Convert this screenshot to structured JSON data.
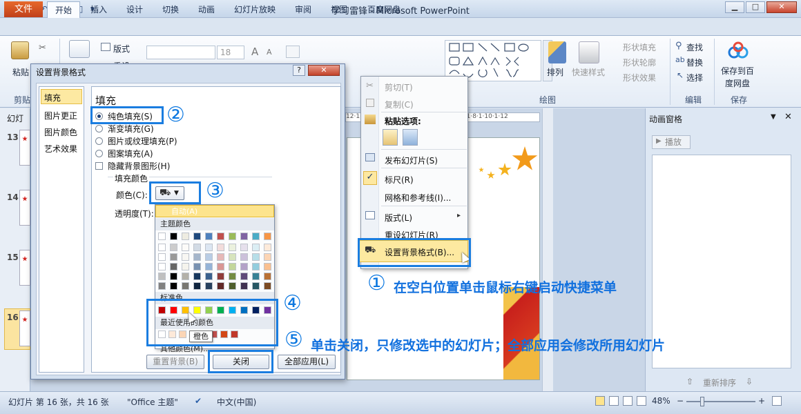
{
  "window": {
    "title": "学习雷锋 - Microsoft PowerPoint",
    "min": "▁",
    "max": "□",
    "close": "✕"
  },
  "ribbon_tabs": [
    "文件",
    "开始",
    "插入",
    "设计",
    "切换",
    "动画",
    "幻灯片放映",
    "审阅",
    "视图",
    "百度网盘"
  ],
  "ribbon": {
    "paste": "粘贴",
    "layout": "版式",
    "reset_short": "重设",
    "font_size": "18",
    "grow_font": "A",
    "shrink_font": "A",
    "arrange": "排列",
    "quick_style": "快速样式",
    "shape_fill": "形状填充",
    "shape_outline": "形状轮廓",
    "shape_effect": "形状效果",
    "find": "查找",
    "replace": "替换",
    "select": "选择",
    "save_baidu_1": "保存到百",
    "save_baidu_2": "度网盘",
    "group_clipboard": "剪贴",
    "group_drawing": "绘图",
    "group_edit": "编辑",
    "group_save": "保存"
  },
  "left_panel": {
    "tab_label": "幻灯",
    "slide_numbers": [
      "13",
      "14",
      "15",
      "16"
    ]
  },
  "ruler_text": "12·1·10·1·8·1·6·1·4·1·2·1·0·1·2·1·4·1·6·1·8·1·10·1·12",
  "animation_pane": {
    "title": "动画窗格",
    "play": "播放",
    "reorder": "重新排序"
  },
  "dialog": {
    "title": "设置背景格式",
    "help": "?",
    "close": "✕",
    "nav": [
      "填充",
      "图片更正",
      "图片颜色",
      "艺术效果"
    ],
    "section_title": "填充",
    "options": [
      "纯色填充(S)",
      "渐变填充(G)",
      "图片或纹理填充(P)",
      "图案填充(A)"
    ],
    "hide_bg": "隐藏背景图形(H)",
    "fill_color_group": "填充颜色",
    "color_label": "颜色(C):",
    "transparency_label": "透明度(T):",
    "reset_button": "重置背景(B)",
    "close_button": "关闭",
    "apply_all_button": "全部应用(L)"
  },
  "palette": {
    "auto": "自动(A)",
    "theme_colors": "主题颜色",
    "standard_colors": "标准色",
    "recent_colors": "最近使用的颜色",
    "more_colors": "其他颜色(M)...",
    "tooltip": "橙色",
    "theme_top": [
      "#ffffff",
      "#000000",
      "#eeece1",
      "#1f497d",
      "#4f81bd",
      "#c0504d",
      "#9bbb59",
      "#8064a2",
      "#4bacc6",
      "#f79646"
    ],
    "standard": [
      "#c00000",
      "#ff0000",
      "#ffc000",
      "#ffff00",
      "#92d050",
      "#00b050",
      "#00b0f0",
      "#0070c0",
      "#002060",
      "#7030a0"
    ],
    "recent": [
      "#ffffff",
      "#fde9d9",
      "#fbd5b5",
      "#f79646",
      "#e36c09",
      "#c0504d",
      "#d34817",
      "#c0392b"
    ]
  },
  "context_menu": {
    "cut": "剪切(T)",
    "copy": "复制(C)",
    "paste_options": "粘贴选项:",
    "publish": "发布幻灯片(S)",
    "ruler": "标尺(R)",
    "grid": "网格和参考线(I)...",
    "layout": "版式(L)",
    "reset": "重设幻灯片(R)",
    "format_bg": "设置背景格式(B)...",
    "check": "✓",
    "arrow": "▸"
  },
  "annotations": {
    "c1": "①",
    "t1": "在空白位置单击鼠标右键启动快捷菜单",
    "c2": "②",
    "c3": "③",
    "c4": "④",
    "c5": "⑤",
    "t5": "单击关闭，只修改选中的幻灯片；全部应用会修改所用幻灯片"
  },
  "status": {
    "slide_info": "幻灯片 第 16 张，共 16 张",
    "theme": "\"Office 主题\"",
    "language": "中文(中国)",
    "zoom": "48%",
    "minus": "−",
    "plus": "+"
  }
}
